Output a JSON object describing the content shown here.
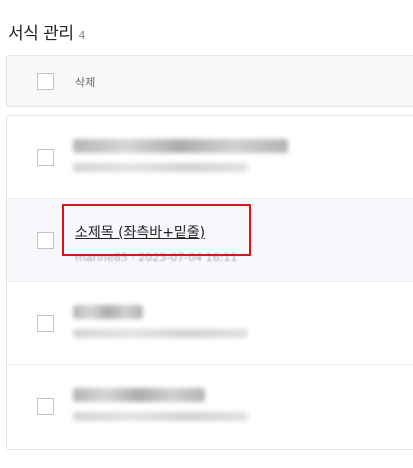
{
  "page": {
    "title": "서식 관리",
    "count": "4"
  },
  "header": {
    "delete_label": "삭제"
  },
  "items": [
    {
      "title": "",
      "meta": "",
      "blurred": true
    },
    {
      "title": "소제목 (좌측바+밑줄)",
      "meta": "marine85 · 2023-07-04 16:11",
      "blurred": false,
      "highlighted": true
    },
    {
      "title": "",
      "meta": "",
      "blurred": true
    },
    {
      "title": "",
      "meta": "",
      "blurred": true
    }
  ],
  "colors": {
    "annotation_box": "#e0121a"
  }
}
